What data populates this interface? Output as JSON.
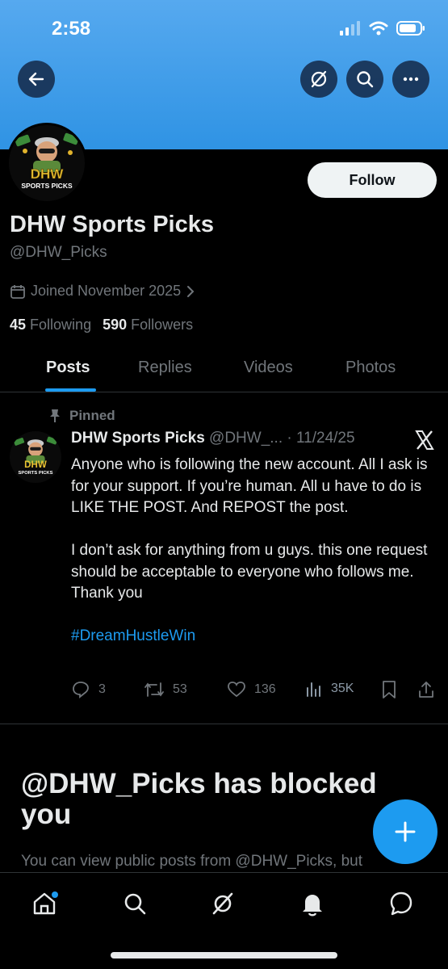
{
  "status": {
    "time": "2:58"
  },
  "profile": {
    "name": "DHW Sports Picks",
    "handle": "@DHW_Picks",
    "joined": "Joined November 2025",
    "following_count": "45",
    "following_label": "Following",
    "followers_count": "590",
    "followers_label": "Followers",
    "follow_button": "Follow",
    "avatar_text_top": "DHW",
    "avatar_text_bottom": "SPORTS PICKS"
  },
  "tabs": [
    {
      "label": "Posts",
      "active": true
    },
    {
      "label": "Replies",
      "active": false
    },
    {
      "label": "Videos",
      "active": false
    },
    {
      "label": "Photos",
      "active": false
    }
  ],
  "post": {
    "pinned_label": "Pinned",
    "author_name": "DHW Sports Picks",
    "author_handle": "@DHW_...",
    "date": "· 11/24/25",
    "paragraphs": [
      "Anyone who is following the new account. All I ask is for your support. If you’re human. All u have to do is LIKE THE POST. And REPOST the post.",
      "I don’t ask for anything from u guys. this one request should be acceptable to everyone who follows me. Thank you"
    ],
    "hashtag": "#DreamHustleWin",
    "replies": "3",
    "reposts": "53",
    "likes": "136",
    "views": "35K"
  },
  "blocked": {
    "title": "@DHW_Picks has blocked you",
    "subtitle": "You can view public posts from @DHW_Picks, but"
  },
  "colors": {
    "accent": "#1d9bf0",
    "banner": "#3a9be8",
    "background": "#000000",
    "muted": "#71767b"
  },
  "icons": [
    "back-arrow-icon",
    "grok-icon",
    "search-icon",
    "more-icon",
    "calendar-icon",
    "chevron-right-icon",
    "pin-icon",
    "x-logo-icon",
    "reply-icon",
    "repost-icon",
    "like-icon",
    "views-icon",
    "bookmark-icon",
    "share-icon",
    "compose-plus-icon",
    "home-icon",
    "explore-icon",
    "notifications-icon",
    "messages-icon"
  ]
}
